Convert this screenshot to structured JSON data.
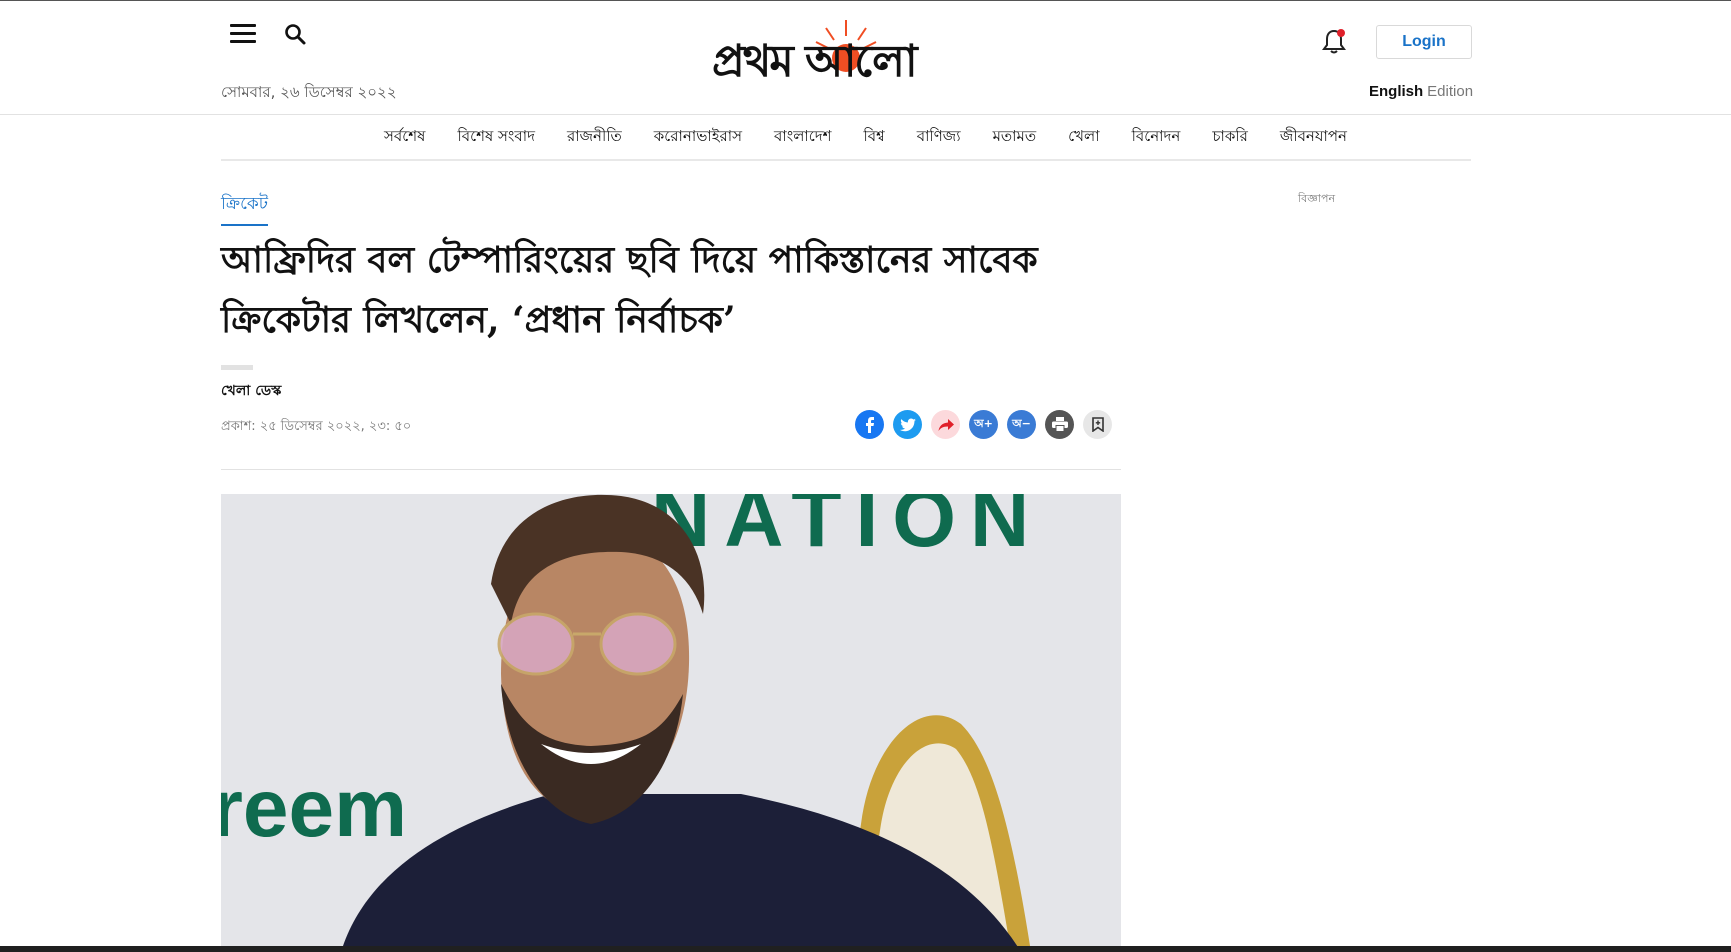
{
  "header": {
    "date": "সোমবার, ২৬ ডিসেম্বর ২০২২",
    "logo_text": "প্রথম আলো",
    "login_label": "Login",
    "edition_lang": "English",
    "edition_word": "Edition"
  },
  "nav": {
    "items": [
      "সর্বশেষ",
      "বিশেষ সংবাদ",
      "রাজনীতি",
      "করোনাভাইরাস",
      "বাংলাদেশ",
      "বিশ্ব",
      "বাণিজ্য",
      "মতামত",
      "খেলা",
      "বিনোদন",
      "চাকরি",
      "জীবনযাপন"
    ]
  },
  "article": {
    "category": "ক্রিকেট",
    "headline": "আফ্রিদির বল টেম্পারিংয়ের ছবি দিয়ে পাকিস্তানের সাবেক ক্রিকেটার লিখলেন, ‘প্রধান নির্বাচক’",
    "author": "খেলা ডেস্ক",
    "published": "প্রকাশ: ২৫ ডিসেম্বর ২০২২, ২৩: ৫০",
    "font_increase": "অ+",
    "font_decrease": "অ−",
    "photo_text_top": "NATION",
    "photo_text_side": "reem"
  },
  "sidebar": {
    "ad_label": "বিজ্ঞাপন"
  },
  "colors": {
    "accent": "#1a73c8",
    "facebook": "#1877f2",
    "twitter": "#1d9bf0",
    "logo_sun": "#f04e23"
  }
}
